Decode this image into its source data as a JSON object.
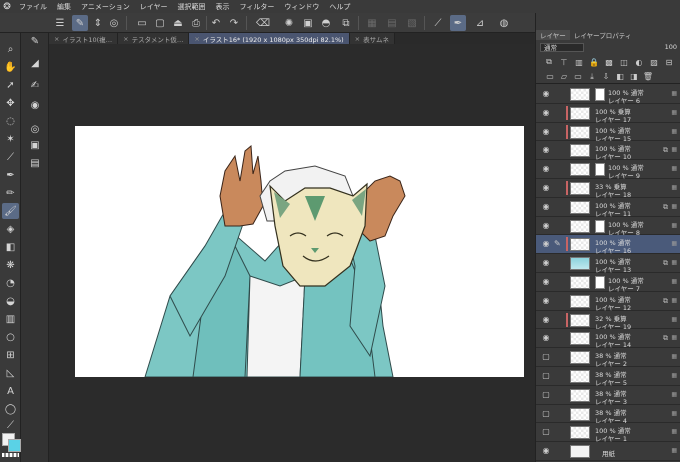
{
  "menubar": {
    "items": [
      "ファイル",
      "編集",
      "アニメーション",
      "レイヤー",
      "選択範囲",
      "表示",
      "フィルター",
      "ウィンドウ",
      "ヘルプ"
    ]
  },
  "tabs": [
    {
      "label": "イラスト10(複…",
      "active": false
    },
    {
      "label": "テスタメント仮…",
      "active": false
    },
    {
      "label": "イラスト16* (1920 x 1080px 350dpi 82.1%)",
      "active": true
    },
    {
      "label": "表サムネ",
      "active": false
    }
  ],
  "panel": {
    "tabs": [
      "レイヤー",
      "レイヤープロパティ"
    ],
    "blend_mode": "通常",
    "opacity": "100"
  },
  "layers": [
    {
      "opacity": "100 %",
      "mode": "通常",
      "name": "レイヤー 6",
      "visible": true,
      "mask": true
    },
    {
      "opacity": "100 %",
      "mode": "乗算",
      "name": "レイヤー 17",
      "visible": true,
      "clip": true
    },
    {
      "opacity": "100 %",
      "mode": "通常",
      "name": "レイヤー 15",
      "visible": true,
      "clip": true
    },
    {
      "opacity": "100 %",
      "mode": "通常",
      "name": "レイヤー 10",
      "visible": true,
      "mark": true
    },
    {
      "opacity": "100 %",
      "mode": "通常",
      "name": "レイヤー 9",
      "visible": true,
      "mask": true
    },
    {
      "opacity": "33 %",
      "mode": "乗算",
      "name": "レイヤー 18",
      "visible": true,
      "clip": true
    },
    {
      "opacity": "100 %",
      "mode": "通常",
      "name": "レイヤー 11",
      "visible": true,
      "mark": true
    },
    {
      "opacity": "100 %",
      "mode": "通常",
      "name": "レイヤー 8",
      "visible": true,
      "mask": true
    },
    {
      "opacity": "100 %",
      "mode": "通常",
      "name": "レイヤー 16",
      "visible": true,
      "selected": true,
      "clip": true
    },
    {
      "opacity": "100 %",
      "mode": "通常",
      "name": "レイヤー 13",
      "visible": true,
      "mark": true,
      "thumb": "sky"
    },
    {
      "opacity": "100 %",
      "mode": "通常",
      "name": "レイヤー 7",
      "visible": true,
      "mask": true
    },
    {
      "opacity": "100 %",
      "mode": "通常",
      "name": "レイヤー 12",
      "visible": true,
      "mark": true
    },
    {
      "opacity": "32 %",
      "mode": "乗算",
      "name": "レイヤー 19",
      "visible": true,
      "clip": true
    },
    {
      "opacity": "100 %",
      "mode": "通常",
      "name": "レイヤー 14",
      "visible": true,
      "mark": true
    },
    {
      "opacity": "38 %",
      "mode": "通常",
      "name": "レイヤー 2",
      "visible": false
    },
    {
      "opacity": "38 %",
      "mode": "通常",
      "name": "レイヤー 5",
      "visible": false
    },
    {
      "opacity": "38 %",
      "mode": "通常",
      "name": "レイヤー 3",
      "visible": false
    },
    {
      "opacity": "38 %",
      "mode": "通常",
      "name": "レイヤー 4",
      "visible": false
    },
    {
      "opacity": "100 %",
      "mode": "通常",
      "name": "レイヤー 1",
      "visible": false
    },
    {
      "opacity": "",
      "mode": "",
      "name": "用紙",
      "visible": true,
      "paper": true
    }
  ],
  "colors": {
    "main": "#f2f2f2",
    "sub": "#5ad2e6",
    "accent": "#5b6b86"
  }
}
